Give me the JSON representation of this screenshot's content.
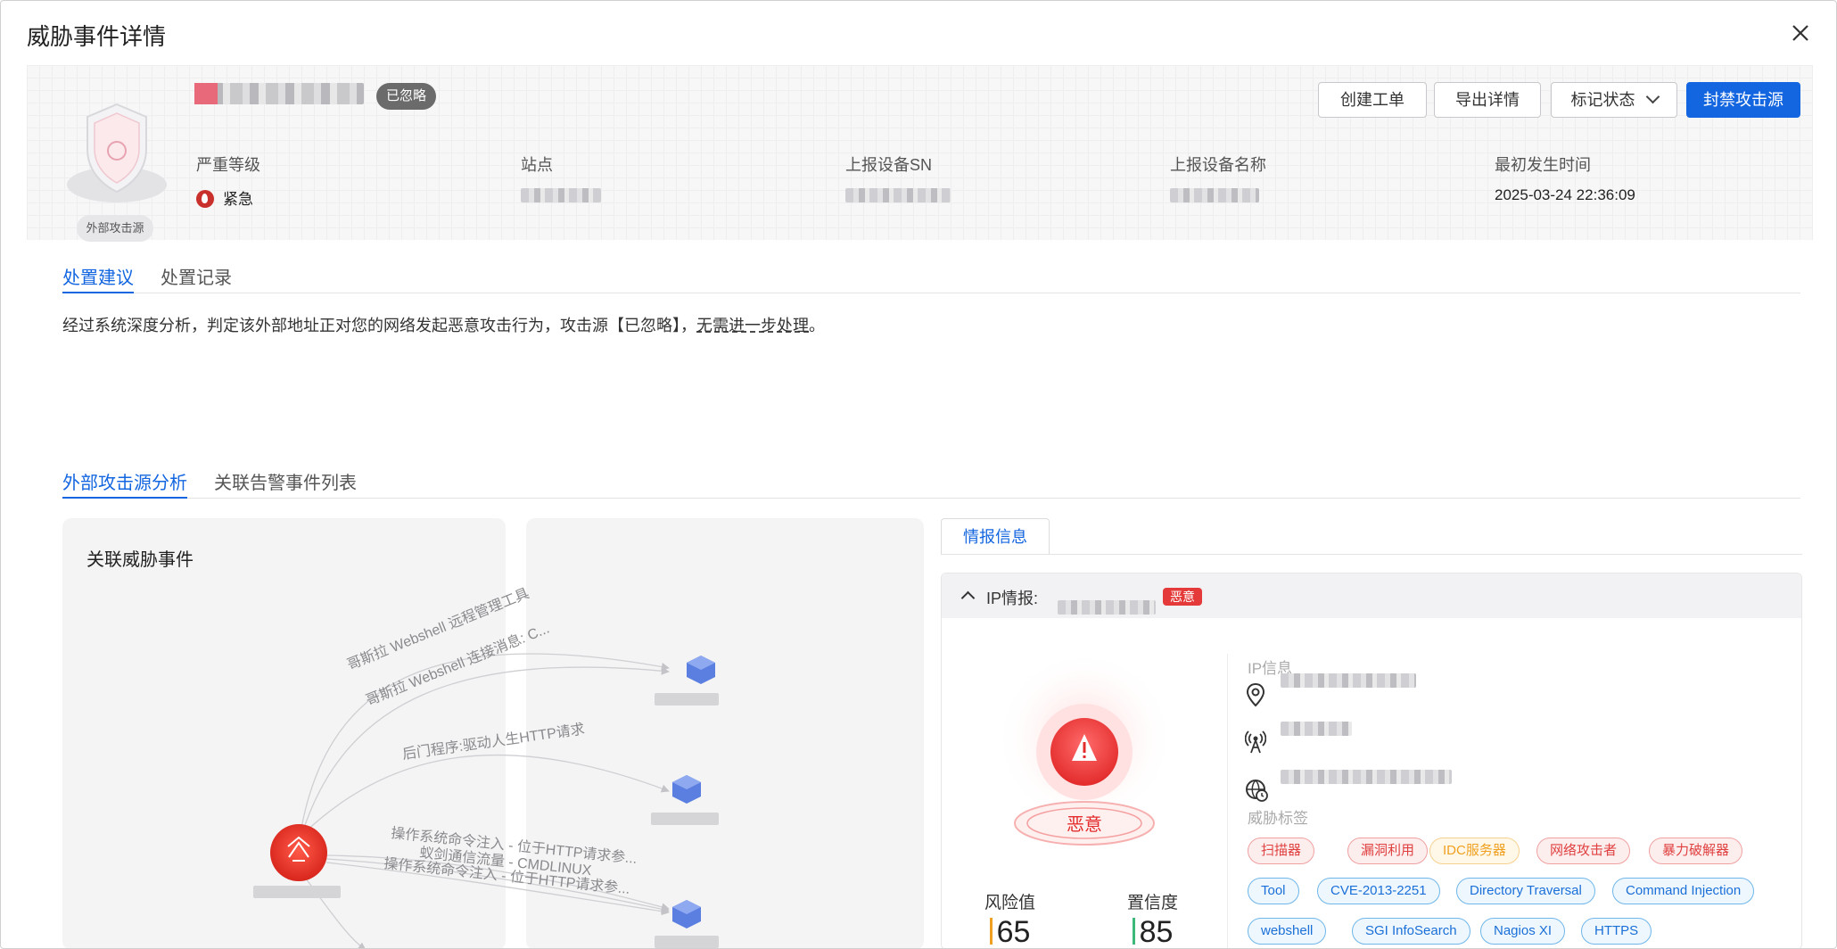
{
  "dialog": {
    "title": "威胁事件详情"
  },
  "header": {
    "emblem_label": "外部攻击源",
    "status_badge": "已忽略",
    "buttons": {
      "create_ticket": "创建工单",
      "export": "导出详情",
      "mark_status": "标记状态",
      "block": "封禁攻击源"
    },
    "fields": {
      "severity_label": "严重等级",
      "severity_value": "紧急",
      "site_label": "站点",
      "sn_label": "上报设备SN",
      "device_name_label": "上报设备名称",
      "first_time_label": "最初发生时间",
      "first_time_value": "2025-03-24 22:36:09"
    }
  },
  "tabs_top": [
    "处置建议",
    "处置记录"
  ],
  "advice": {
    "text": "经过系统深度分析，判定该外部地址正对您的网络发起恶意攻击行为，攻击源【已忽略】，",
    "underline": "无需进一步处理",
    "end": "。"
  },
  "tabs_bottom": [
    "外部攻击源分析",
    "关联告警事件列表"
  ],
  "graph": {
    "title": "关联威胁事件",
    "edges": [
      "哥斯拉 Webshell 远程管理工具",
      "哥斯拉 Webshell 连接消息: C...",
      "后门程序:驱动人生HTTP请求",
      "操作系统命令注入 - 位于HTTP请求参...",
      "蚁剑通信流量 - CMDLINUX",
      "操作系统命令注入 - 位于HTTP请求参..."
    ]
  },
  "intel": {
    "tab": "情报信息",
    "ip_label": "IP情报:",
    "verdict_badge": "恶意",
    "verdict": "恶意",
    "risk_label": "风险值",
    "risk_value": "65",
    "confidence_label": "置信度",
    "confidence_value": "85",
    "info_title": "IP信息",
    "tags_title": "威胁标签",
    "tags": [
      {
        "text": "扫描器",
        "color": "red"
      },
      {
        "text": "漏洞利用",
        "color": "red"
      },
      {
        "text": "IDC服务器",
        "color": "orange"
      },
      {
        "text": "网络攻击者",
        "color": "red"
      },
      {
        "text": "暴力破解器",
        "color": "red"
      },
      {
        "text": "Tool",
        "color": "blue"
      },
      {
        "text": "CVE-2013-2251",
        "color": "blue"
      },
      {
        "text": "Directory Traversal",
        "color": "blue"
      },
      {
        "text": "Command Injection",
        "color": "blue"
      },
      {
        "text": "webshell",
        "color": "blue"
      },
      {
        "text": "SGI InfoSearch",
        "color": "blue"
      },
      {
        "text": "Nagios XI",
        "color": "blue"
      },
      {
        "text": "HTTPS",
        "color": "blue"
      }
    ]
  },
  "colors": {
    "accent": "#1366e0",
    "danger": "#e53a3a",
    "risk_bar": "#f0a020",
    "confidence_bar": "#3cb878"
  }
}
